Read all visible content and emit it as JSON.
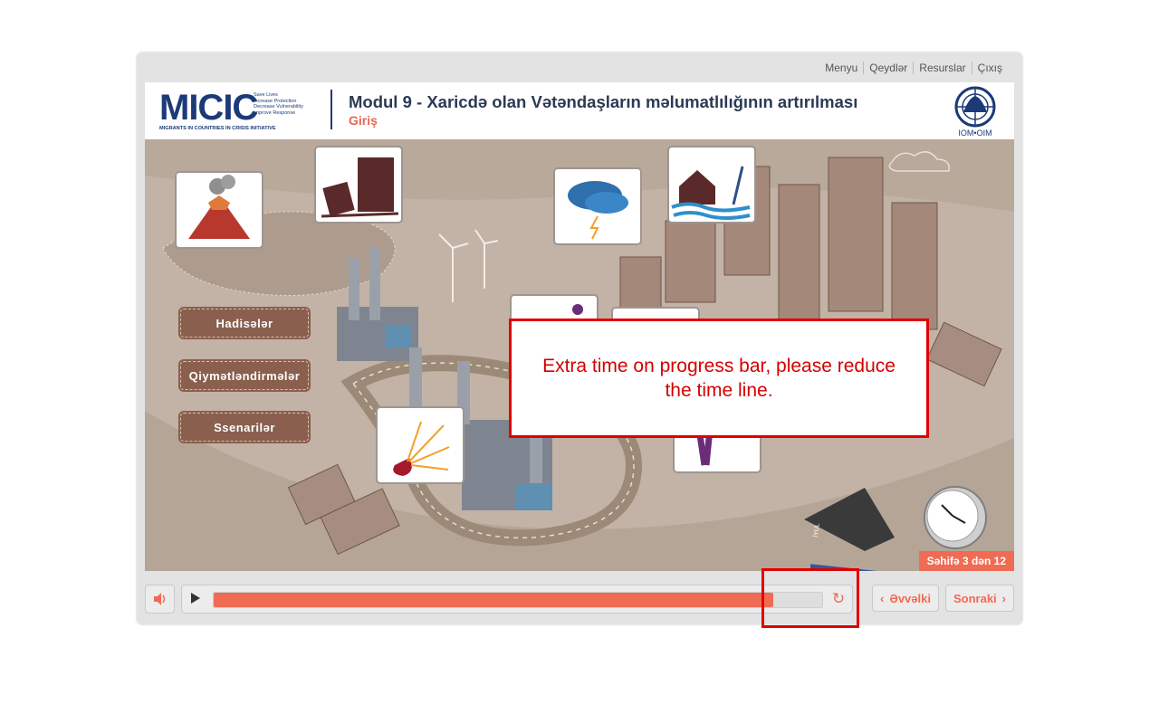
{
  "topmenu": {
    "items": [
      "Menyu",
      "Qeydlər",
      "Resurslar",
      "Çıxış"
    ]
  },
  "header": {
    "logo": {
      "main": "MICIC",
      "taglines": [
        "Save Lives",
        "Increase Protection",
        "Decrease Vulnerability",
        "Improve Response"
      ],
      "sub": "MIGRANTS IN COUNTRIES IN CRISIS INITIATIVE"
    },
    "title": "Modul 9 - Xaricdə olan Vətəndaşların məlumatlılığının artırılması",
    "subtitle": "Giriş",
    "iom_label": "IOM•OIM"
  },
  "scene": {
    "buttons": [
      "Hadisələr",
      "Qiymətləndirmələr",
      "Ssenarilər"
    ],
    "calendar_text": "İYUL",
    "page_indicator": "Səhifə 3 dən 12"
  },
  "controls": {
    "progress": 0.92,
    "prev_label": "Əvvəlki",
    "next_label": "Sonraki"
  },
  "annotation": {
    "text": "Extra time on progress bar, please reduce the time line."
  },
  "colors": {
    "accent": "#f06b53",
    "brand_blue": "#1c3a78",
    "button_brown": "#8a5f4e",
    "annotation_red": "#e00000"
  }
}
